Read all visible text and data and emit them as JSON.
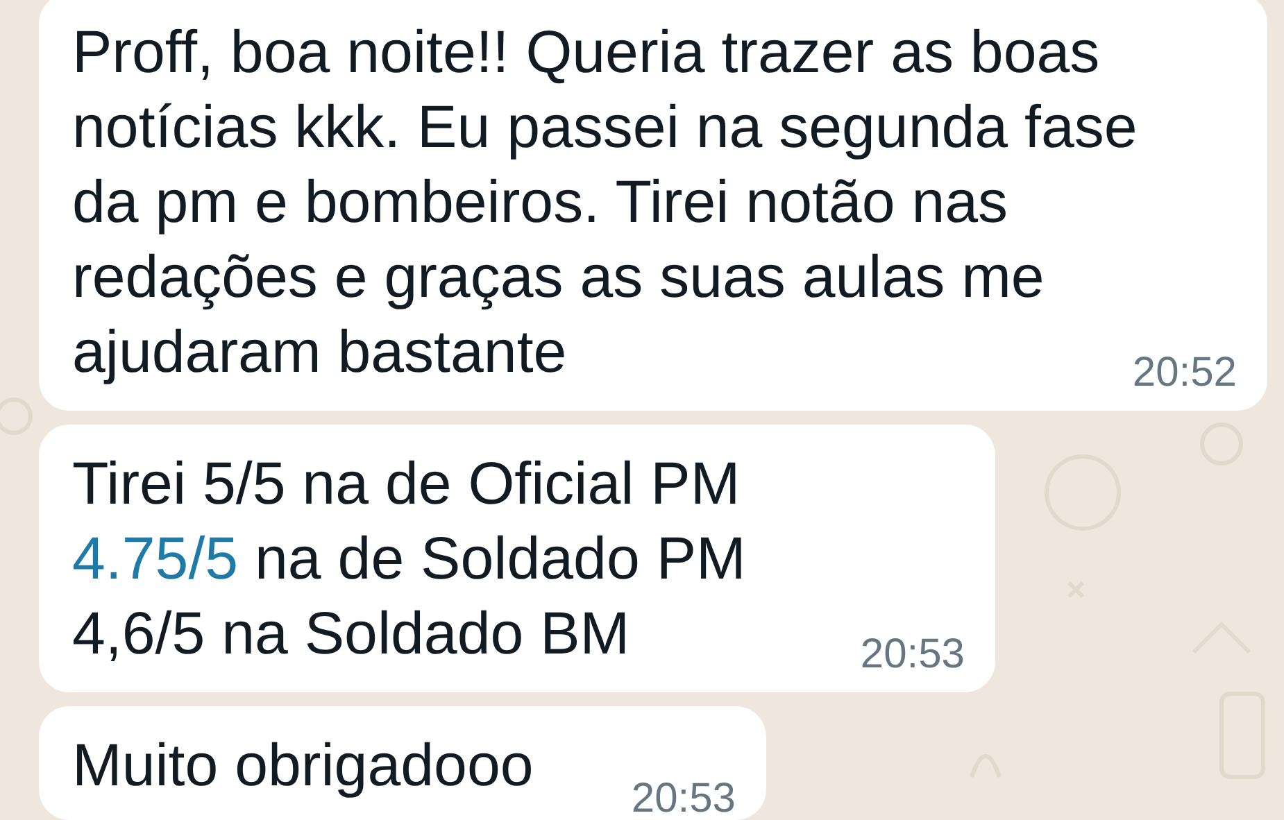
{
  "messages": [
    {
      "lines": [
        {
          "text": "Proff, boa noite!! Queria trazer as boas"
        },
        {
          "text": "notícias kkk. Eu passei na segunda fase"
        },
        {
          "text": "da pm e bombeiros. Tirei notão nas"
        },
        {
          "text": "redações e graças as suas aulas me"
        },
        {
          "text": "ajudaram bastante"
        }
      ],
      "time": "20:52"
    },
    {
      "lines": [
        {
          "text": "Tirei 5/5 na de Oficial PM"
        },
        {
          "link": "4.75/5",
          "text": " na de Soldado PM"
        },
        {
          "text": "4,6/5 na Soldado BM"
        }
      ],
      "time": "20:53"
    },
    {
      "lines": [
        {
          "text": "Muito obrigadooo"
        }
      ],
      "time": "20:53",
      "inline_time": true
    }
  ]
}
